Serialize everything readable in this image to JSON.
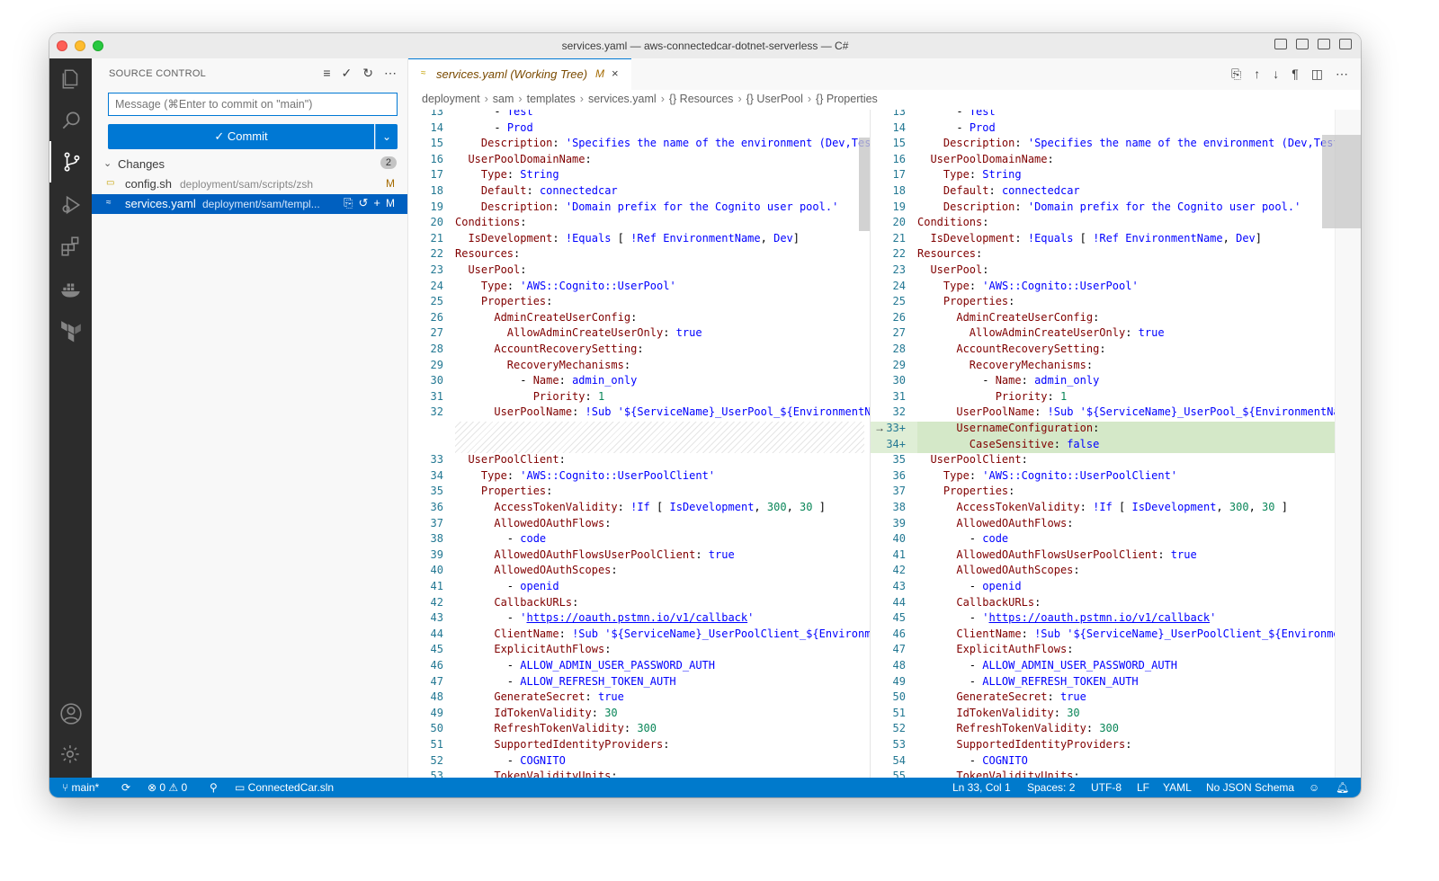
{
  "window": {
    "title": "services.yaml — aws-connectedcar-dotnet-serverless — C#"
  },
  "sidebar": {
    "title": "SOURCE CONTROL",
    "message_placeholder": "Message (⌘Enter to commit on \"main\")",
    "commit_label": "✓ Commit",
    "changes_label": "Changes",
    "changes_count": "2",
    "files": [
      {
        "name": "config.sh",
        "path": "deployment/sam/scripts/zsh",
        "status": "M"
      },
      {
        "name": "services.yaml",
        "path": "deployment/sam/templ...",
        "status": "M"
      }
    ]
  },
  "tab": {
    "label": "services.yaml (Working Tree)",
    "status": "M",
    "close": "×"
  },
  "breadcrumb": [
    "deployment",
    "sam",
    "templates",
    "services.yaml",
    "{} Resources",
    "{} UserPool",
    "{} Properties"
  ],
  "editor": {
    "left_line_numbers": [
      "13",
      "14",
      "15",
      "16",
      "17",
      "18",
      "19",
      "20",
      "21",
      "22",
      "23",
      "24",
      "25",
      "26",
      "27",
      "28",
      "29",
      "30",
      "31",
      "32",
      "",
      "",
      "33",
      "34",
      "35",
      "36",
      "37",
      "38",
      "39",
      "40",
      "41",
      "42",
      "43",
      "44",
      "45",
      "46",
      "47",
      "48",
      "49",
      "50",
      "51",
      "52",
      "53"
    ],
    "right_line_numbers": [
      "13",
      "14",
      "15",
      "16",
      "17",
      "18",
      "19",
      "20",
      "21",
      "22",
      "23",
      "24",
      "25",
      "26",
      "27",
      "28",
      "29",
      "30",
      "31",
      "32",
      "33+",
      "34+",
      "35",
      "36",
      "37",
      "38",
      "39",
      "40",
      "41",
      "42",
      "43",
      "44",
      "45",
      "46",
      "47",
      "48",
      "49",
      "50",
      "51",
      "52",
      "53",
      "54",
      "55"
    ],
    "lines": [
      "      - Test",
      "      - Prod",
      "    Description: 'Specifies the name of the environment (Dev,Test",
      "  UserPoolDomainName:",
      "    Type: String",
      "    Default: connectedcar",
      "    Description: 'Domain prefix for the Cognito user pool.'",
      "Conditions:",
      "  IsDevelopment: !Equals [ !Ref EnvironmentName, Dev]",
      "Resources:",
      "  UserPool:",
      "    Type: 'AWS::Cognito::UserPool'",
      "    Properties:",
      "      AdminCreateUserConfig:",
      "        AllowAdminCreateUserOnly: true",
      "      AccountRecoverySetting:",
      "        RecoveryMechanisms:",
      "          - Name: admin_only",
      "            Priority: 1",
      "      UserPoolName: !Sub '${ServiceName}_UserPool_${EnvironmentNa",
      "      UsernameConfiguration:",
      "        CaseSensitive: false",
      "  UserPoolClient:",
      "    Type: 'AWS::Cognito::UserPoolClient'",
      "    Properties:",
      "      AccessTokenValidity: !If [ IsDevelopment, 300, 30 ]",
      "      AllowedOAuthFlows:",
      "        - code",
      "      AllowedOAuthFlowsUserPoolClient: true",
      "      AllowedOAuthScopes:",
      "        - openid",
      "      CallbackURLs:",
      "        - 'https://oauth.pstmn.io/v1/callback'",
      "      ClientName: !Sub '${ServiceName}_UserPoolClient_${Environme",
      "      ExplicitAuthFlows:",
      "        - ALLOW_ADMIN_USER_PASSWORD_AUTH",
      "        - ALLOW_REFRESH_TOKEN_AUTH",
      "      GenerateSecret: true",
      "      IdTokenValidity: 30",
      "      RefreshTokenValidity: 300",
      "      SupportedIdentityProviders:",
      "        - COGNITO",
      "      TokenValidityUnits:"
    ]
  },
  "status": {
    "branch": "main*",
    "problems": "⊗ 0 ⚠ 0",
    "solution": "ConnectedCar.sln",
    "cursor": "Ln 33, Col 1",
    "spaces": "Spaces: 2",
    "encoding": "UTF-8",
    "eol": "LF",
    "language": "YAML",
    "schema": "No JSON Schema"
  },
  "colors": {
    "accent": "#0078d4",
    "statusbar": "#007acc",
    "activitybar": "#2c2c2c",
    "added": "#d4e8c8"
  }
}
